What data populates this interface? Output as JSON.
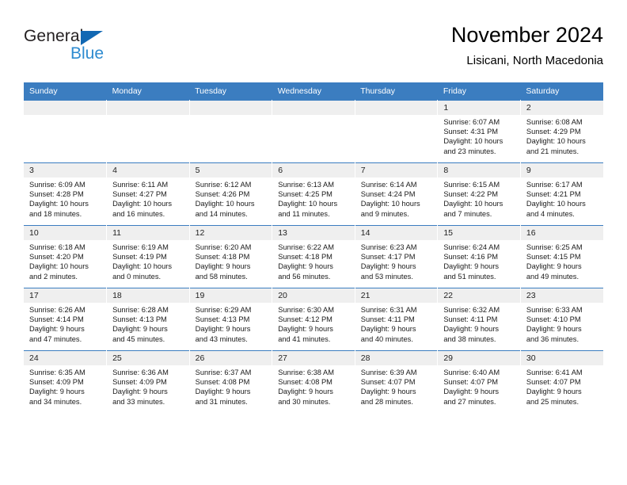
{
  "brand": {
    "name_part1": "General",
    "name_part2": "Blue",
    "triangle_color": "#1268b3",
    "blue_color": "#2e8bd0"
  },
  "header": {
    "title": "November 2024",
    "subtitle": "Lisicani, North Macedonia"
  },
  "theme": {
    "header_bg": "#3b7dc0",
    "daynum_bg": "#efefef",
    "row_border": "#3b7dc0"
  },
  "calendar": {
    "weekday_headers": [
      "Sunday",
      "Monday",
      "Tuesday",
      "Wednesday",
      "Thursday",
      "Friday",
      "Saturday"
    ],
    "weeks": [
      [
        {
          "day": "",
          "empty": true
        },
        {
          "day": "",
          "empty": true
        },
        {
          "day": "",
          "empty": true
        },
        {
          "day": "",
          "empty": true
        },
        {
          "day": "",
          "empty": true
        },
        {
          "day": "1",
          "sunrise": "Sunrise: 6:07 AM",
          "sunset": "Sunset: 4:31 PM",
          "daylight1": "Daylight: 10 hours",
          "daylight2": "and 23 minutes."
        },
        {
          "day": "2",
          "sunrise": "Sunrise: 6:08 AM",
          "sunset": "Sunset: 4:29 PM",
          "daylight1": "Daylight: 10 hours",
          "daylight2": "and 21 minutes."
        }
      ],
      [
        {
          "day": "3",
          "sunrise": "Sunrise: 6:09 AM",
          "sunset": "Sunset: 4:28 PM",
          "daylight1": "Daylight: 10 hours",
          "daylight2": "and 18 minutes."
        },
        {
          "day": "4",
          "sunrise": "Sunrise: 6:11 AM",
          "sunset": "Sunset: 4:27 PM",
          "daylight1": "Daylight: 10 hours",
          "daylight2": "and 16 minutes."
        },
        {
          "day": "5",
          "sunrise": "Sunrise: 6:12 AM",
          "sunset": "Sunset: 4:26 PM",
          "daylight1": "Daylight: 10 hours",
          "daylight2": "and 14 minutes."
        },
        {
          "day": "6",
          "sunrise": "Sunrise: 6:13 AM",
          "sunset": "Sunset: 4:25 PM",
          "daylight1": "Daylight: 10 hours",
          "daylight2": "and 11 minutes."
        },
        {
          "day": "7",
          "sunrise": "Sunrise: 6:14 AM",
          "sunset": "Sunset: 4:24 PM",
          "daylight1": "Daylight: 10 hours",
          "daylight2": "and 9 minutes."
        },
        {
          "day": "8",
          "sunrise": "Sunrise: 6:15 AM",
          "sunset": "Sunset: 4:22 PM",
          "daylight1": "Daylight: 10 hours",
          "daylight2": "and 7 minutes."
        },
        {
          "day": "9",
          "sunrise": "Sunrise: 6:17 AM",
          "sunset": "Sunset: 4:21 PM",
          "daylight1": "Daylight: 10 hours",
          "daylight2": "and 4 minutes."
        }
      ],
      [
        {
          "day": "10",
          "sunrise": "Sunrise: 6:18 AM",
          "sunset": "Sunset: 4:20 PM",
          "daylight1": "Daylight: 10 hours",
          "daylight2": "and 2 minutes."
        },
        {
          "day": "11",
          "sunrise": "Sunrise: 6:19 AM",
          "sunset": "Sunset: 4:19 PM",
          "daylight1": "Daylight: 10 hours",
          "daylight2": "and 0 minutes."
        },
        {
          "day": "12",
          "sunrise": "Sunrise: 6:20 AM",
          "sunset": "Sunset: 4:18 PM",
          "daylight1": "Daylight: 9 hours",
          "daylight2": "and 58 minutes."
        },
        {
          "day": "13",
          "sunrise": "Sunrise: 6:22 AM",
          "sunset": "Sunset: 4:18 PM",
          "daylight1": "Daylight: 9 hours",
          "daylight2": "and 56 minutes."
        },
        {
          "day": "14",
          "sunrise": "Sunrise: 6:23 AM",
          "sunset": "Sunset: 4:17 PM",
          "daylight1": "Daylight: 9 hours",
          "daylight2": "and 53 minutes."
        },
        {
          "day": "15",
          "sunrise": "Sunrise: 6:24 AM",
          "sunset": "Sunset: 4:16 PM",
          "daylight1": "Daylight: 9 hours",
          "daylight2": "and 51 minutes."
        },
        {
          "day": "16",
          "sunrise": "Sunrise: 6:25 AM",
          "sunset": "Sunset: 4:15 PM",
          "daylight1": "Daylight: 9 hours",
          "daylight2": "and 49 minutes."
        }
      ],
      [
        {
          "day": "17",
          "sunrise": "Sunrise: 6:26 AM",
          "sunset": "Sunset: 4:14 PM",
          "daylight1": "Daylight: 9 hours",
          "daylight2": "and 47 minutes."
        },
        {
          "day": "18",
          "sunrise": "Sunrise: 6:28 AM",
          "sunset": "Sunset: 4:13 PM",
          "daylight1": "Daylight: 9 hours",
          "daylight2": "and 45 minutes."
        },
        {
          "day": "19",
          "sunrise": "Sunrise: 6:29 AM",
          "sunset": "Sunset: 4:13 PM",
          "daylight1": "Daylight: 9 hours",
          "daylight2": "and 43 minutes."
        },
        {
          "day": "20",
          "sunrise": "Sunrise: 6:30 AM",
          "sunset": "Sunset: 4:12 PM",
          "daylight1": "Daylight: 9 hours",
          "daylight2": "and 41 minutes."
        },
        {
          "day": "21",
          "sunrise": "Sunrise: 6:31 AM",
          "sunset": "Sunset: 4:11 PM",
          "daylight1": "Daylight: 9 hours",
          "daylight2": "and 40 minutes."
        },
        {
          "day": "22",
          "sunrise": "Sunrise: 6:32 AM",
          "sunset": "Sunset: 4:11 PM",
          "daylight1": "Daylight: 9 hours",
          "daylight2": "and 38 minutes."
        },
        {
          "day": "23",
          "sunrise": "Sunrise: 6:33 AM",
          "sunset": "Sunset: 4:10 PM",
          "daylight1": "Daylight: 9 hours",
          "daylight2": "and 36 minutes."
        }
      ],
      [
        {
          "day": "24",
          "sunrise": "Sunrise: 6:35 AM",
          "sunset": "Sunset: 4:09 PM",
          "daylight1": "Daylight: 9 hours",
          "daylight2": "and 34 minutes."
        },
        {
          "day": "25",
          "sunrise": "Sunrise: 6:36 AM",
          "sunset": "Sunset: 4:09 PM",
          "daylight1": "Daylight: 9 hours",
          "daylight2": "and 33 minutes."
        },
        {
          "day": "26",
          "sunrise": "Sunrise: 6:37 AM",
          "sunset": "Sunset: 4:08 PM",
          "daylight1": "Daylight: 9 hours",
          "daylight2": "and 31 minutes."
        },
        {
          "day": "27",
          "sunrise": "Sunrise: 6:38 AM",
          "sunset": "Sunset: 4:08 PM",
          "daylight1": "Daylight: 9 hours",
          "daylight2": "and 30 minutes."
        },
        {
          "day": "28",
          "sunrise": "Sunrise: 6:39 AM",
          "sunset": "Sunset: 4:07 PM",
          "daylight1": "Daylight: 9 hours",
          "daylight2": "and 28 minutes."
        },
        {
          "day": "29",
          "sunrise": "Sunrise: 6:40 AM",
          "sunset": "Sunset: 4:07 PM",
          "daylight1": "Daylight: 9 hours",
          "daylight2": "and 27 minutes."
        },
        {
          "day": "30",
          "sunrise": "Sunrise: 6:41 AM",
          "sunset": "Sunset: 4:07 PM",
          "daylight1": "Daylight: 9 hours",
          "daylight2": "and 25 minutes."
        }
      ]
    ]
  }
}
